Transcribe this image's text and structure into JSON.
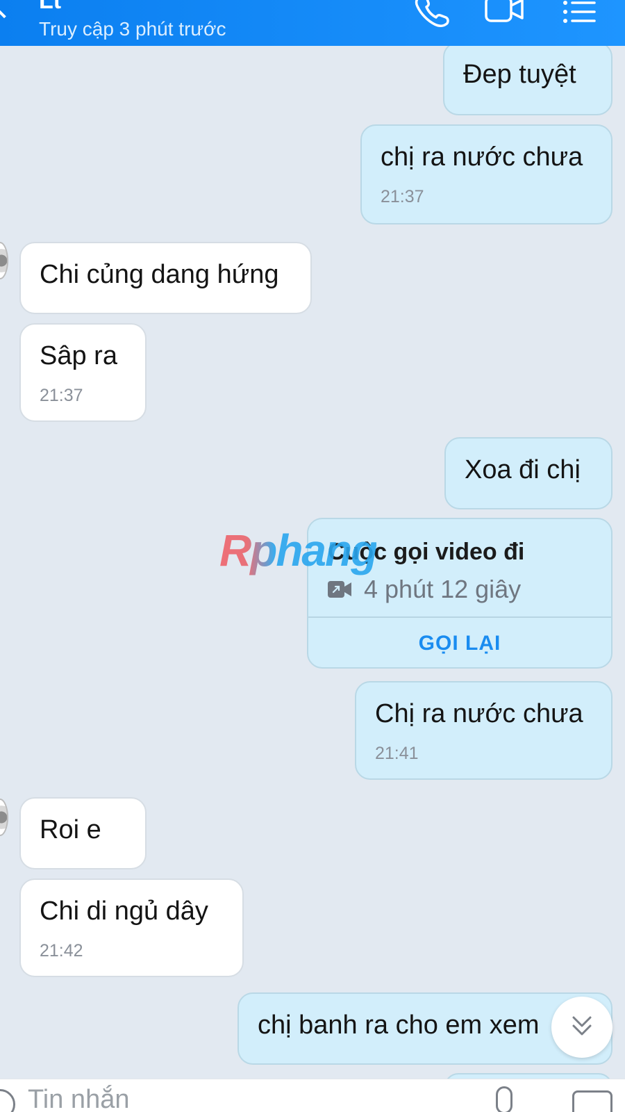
{
  "header": {
    "contact_name": "Lt",
    "status": "Truy cập 3 phút trước"
  },
  "messages": [
    {
      "direction": "out",
      "text": "Đep tuyệt"
    },
    {
      "direction": "out",
      "text": "chị ra nước chưa",
      "time": "21:37"
    },
    {
      "direction": "in",
      "text": "Chi củng dang hứng"
    },
    {
      "direction": "in",
      "text": "Sâp ra",
      "time": "21:37"
    },
    {
      "direction": "out",
      "text": "Xoa đi chị"
    },
    {
      "direction": "out",
      "text": "Chị ra nước chưa",
      "time": "21:41"
    },
    {
      "direction": "in",
      "text": "Roi e"
    },
    {
      "direction": "in",
      "text": "Chi di ngủ dây",
      "time": "21:42"
    },
    {
      "direction": "out",
      "text": "chị banh ra cho em xem"
    }
  ],
  "call_card": {
    "title": "Cuộc gọi video đi",
    "duration": "4 phút 12 giây",
    "action": "GỌI LẠI"
  },
  "watermark": "Rphang",
  "composer": {
    "placeholder": "Tin nhắn"
  },
  "icons": {
    "back": "chevron-left-icon",
    "call": "phone-icon",
    "video": "video-camera-icon",
    "menu": "list-icon",
    "scroll_down": "double-chevron-down-icon"
  },
  "colors": {
    "header": "#0b7ff0",
    "background": "#e2e9f1",
    "outgoing_bubble": "#d2eefb",
    "incoming_bubble": "#ffffff",
    "accent": "#1a8cf0"
  }
}
